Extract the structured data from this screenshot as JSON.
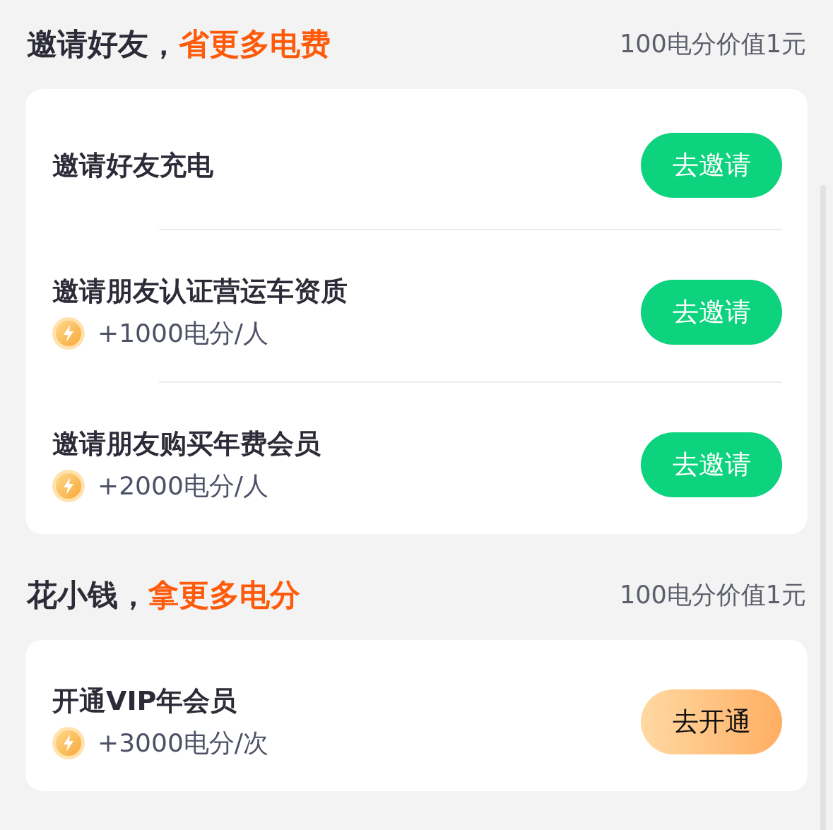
{
  "sections": [
    {
      "title_lead": "邀请好友，",
      "title_highlight": "省更多电费",
      "note": "100电分价值1元",
      "items": [
        {
          "title": "邀请好友充电",
          "button": {
            "label": "去邀请",
            "kind": "green"
          }
        },
        {
          "title": "邀请朋友认证营运车资质",
          "reward": "+1000电分/人",
          "button": {
            "label": "去邀请",
            "kind": "green"
          }
        },
        {
          "title": "邀请朋友购买年费会员",
          "reward": "+2000电分/人",
          "button": {
            "label": "去邀请",
            "kind": "green"
          }
        }
      ]
    },
    {
      "title_lead": "花小钱，",
      "title_highlight": "拿更多电分",
      "note": "100电分价值1元",
      "items": [
        {
          "title": "开通VIP年会员",
          "reward": "+3000电分/次",
          "button": {
            "label": "去开通",
            "kind": "orange"
          }
        }
      ]
    }
  ]
}
